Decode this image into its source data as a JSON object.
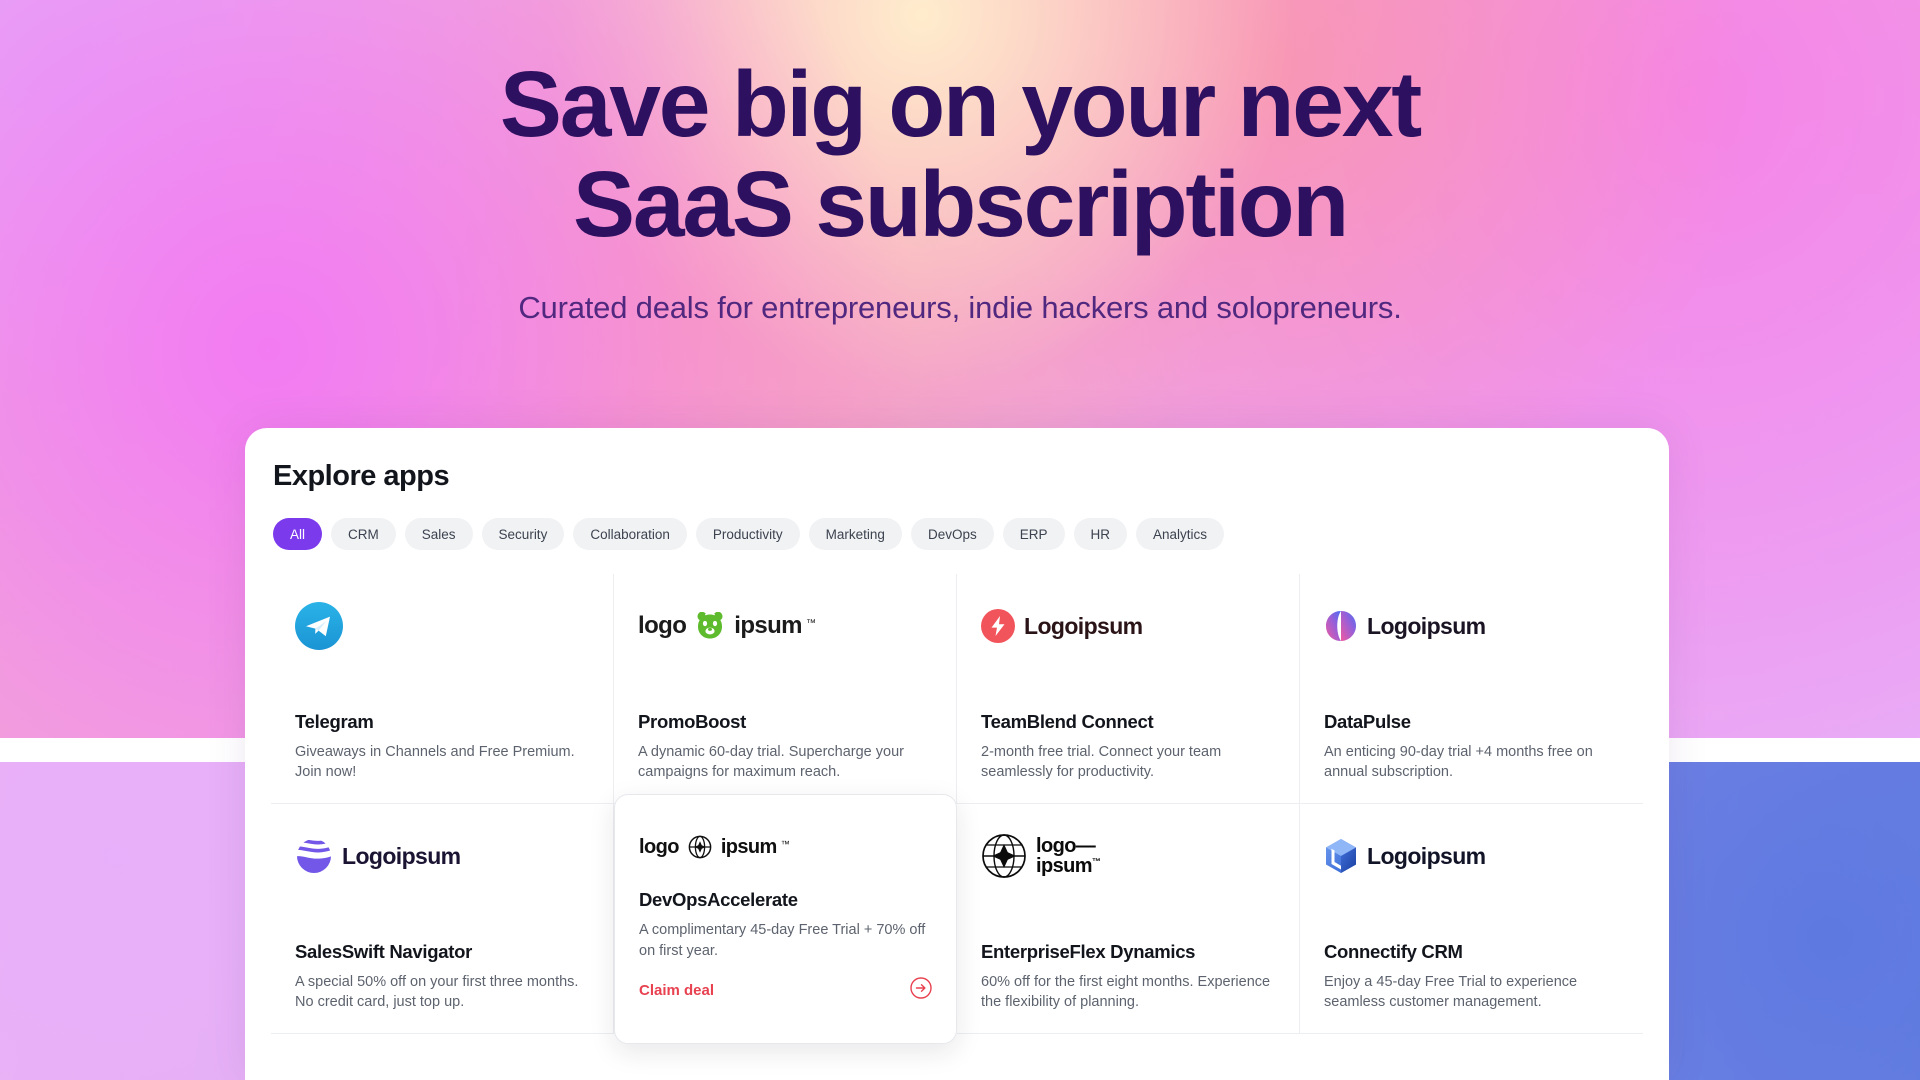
{
  "hero": {
    "title_line1": "Save big on your next",
    "title_line2": "SaaS subscription",
    "subtitle": "Curated deals for entrepreneurs, indie hackers and solopreneurs.",
    "title_color": "#2d1060",
    "subtitle_color": "#51287f"
  },
  "panel": {
    "title": "Explore apps",
    "accent_color": "#7c3aed",
    "cta_color": "#e84150"
  },
  "filters": [
    {
      "label": "All",
      "active": true
    },
    {
      "label": "CRM",
      "active": false
    },
    {
      "label": "Sales",
      "active": false
    },
    {
      "label": "Security",
      "active": false
    },
    {
      "label": "Collaboration",
      "active": false
    },
    {
      "label": "Productivity",
      "active": false
    },
    {
      "label": "Marketing",
      "active": false
    },
    {
      "label": "DevOps",
      "active": false
    },
    {
      "label": "ERP",
      "active": false
    },
    {
      "label": "HR",
      "active": false
    },
    {
      "label": "Analytics",
      "active": false
    }
  ],
  "cards": [
    {
      "name": "Telegram",
      "desc": "Giveaways in Channels and Free Premium. Join now!",
      "logo_kind": "telegram",
      "logo_text": "",
      "featured": false
    },
    {
      "name": "PromoBoost",
      "desc": "A dynamic 60-day trial. Supercharge your campaigns for maximum reach.",
      "logo_kind": "logo-bear-ipsum",
      "logo_text": "logo ipsum",
      "featured": false
    },
    {
      "name": "TeamBlend Connect",
      "desc": "2-month free trial. Connect your team seamlessly for productivity.",
      "logo_kind": "bolt-logoipsum",
      "logo_text": "Logoipsum",
      "featured": false
    },
    {
      "name": "DataPulse",
      "desc": "An enticing 90-day trial +4 months free on annual subscription.",
      "logo_kind": "gradient-logoipsum",
      "logo_text": "Logoipsum",
      "featured": false
    },
    {
      "name": "SalesSwift Navigator",
      "desc": "A special 50% off on your first three months. No credit card, just top up.",
      "logo_kind": "wave-logoipsum",
      "logo_text": "Logoipsum",
      "featured": false
    },
    {
      "name": "DevOpsAccelerate",
      "desc": "A complimentary 45-day Free Trial + 70% off on first year.",
      "logo_kind": "globe-logo-ipsum",
      "logo_text": "logo ipsum",
      "featured": true,
      "cta_label": "Claim deal",
      "cta_icon": "arrow-right-circle-icon"
    },
    {
      "name": "EnterpriseFlex Dynamics",
      "desc": "60% off for the first eight months. Experience the flexibility of planning.",
      "logo_kind": "sphere-logo-ipsum",
      "logo_text": "logo—ipsum",
      "featured": false
    },
    {
      "name": "Connectify CRM",
      "desc": "Enjoy a 45-day Free Trial to experience seamless customer management.",
      "logo_kind": "cube-logoipsum",
      "logo_text": "Logoipsum",
      "featured": false
    }
  ]
}
